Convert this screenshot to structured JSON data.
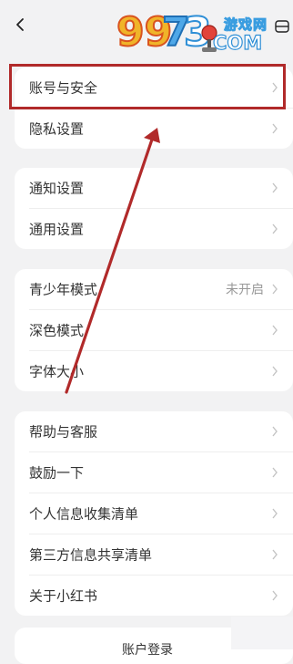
{
  "watermark": {
    "digits": "9973",
    "site": "游戏网",
    "suffix": "COM"
  },
  "groups": [
    {
      "rows": [
        {
          "label": "账号与安全",
          "value": ""
        },
        {
          "label": "隐私设置",
          "value": ""
        }
      ]
    },
    {
      "rows": [
        {
          "label": "通知设置",
          "value": ""
        },
        {
          "label": "通用设置",
          "value": ""
        }
      ]
    },
    {
      "rows": [
        {
          "label": "青少年模式",
          "value": "未开启"
        },
        {
          "label": "深色模式",
          "value": ""
        },
        {
          "label": "字体大小",
          "value": ""
        }
      ]
    },
    {
      "rows": [
        {
          "label": "帮助与客服",
          "value": ""
        },
        {
          "label": "鼓励一下",
          "value": ""
        },
        {
          "label": "个人信息收集清单",
          "value": ""
        },
        {
          "label": "第三方信息共享清单",
          "value": ""
        },
        {
          "label": "关于小红书",
          "value": ""
        }
      ]
    }
  ],
  "bottom_button": {
    "label": "账户登录"
  },
  "colors": {
    "background": "#f2f2f3",
    "highlight": "#b12a2a",
    "chevron": "#c4c4c4",
    "value_text": "#999999"
  },
  "icons": {
    "back": "chevron-left-icon",
    "row_arrow": "chevron-right-icon",
    "corner": "screen-toggle-icon"
  }
}
